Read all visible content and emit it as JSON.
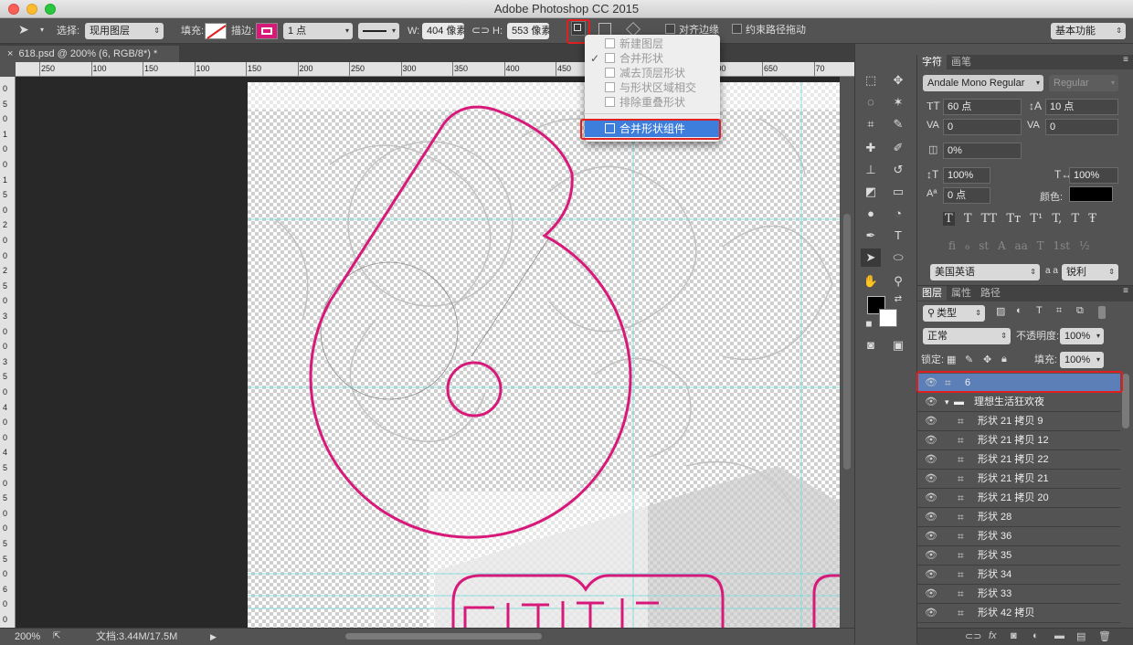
{
  "app_title": "Adobe Photoshop CC 2015",
  "options": {
    "select_label": "选择:",
    "select_value": "现用图层",
    "fill_label": "填充:",
    "stroke_label": "描边:",
    "stroke_size": "1 点",
    "w_label": "W:",
    "w_value": "404 像素",
    "h_label": "H:",
    "h_value": "553 像素",
    "align_edges": "对齐边缘",
    "constrain_path": "约束路径拖动",
    "workspace": "基本功能"
  },
  "document": {
    "tab": "618.psd @ 200% (6, RGB/8*) *"
  },
  "ruler": {
    "h": [
      "250",
      "100",
      "150",
      "100",
      "150",
      "200",
      "250",
      "300",
      "350",
      "400",
      "450",
      "500",
      "550",
      "600",
      "650",
      "70"
    ],
    "v": [
      "0",
      "5",
      "0",
      "1",
      "0",
      "0",
      "1",
      "5",
      "0",
      "2",
      "0",
      "0",
      "2",
      "5",
      "0",
      "3",
      "0",
      "0",
      "3",
      "5",
      "0",
      "4",
      "0",
      "0",
      "4",
      "5",
      "0",
      "5",
      "0",
      "0",
      "5",
      "5",
      "0",
      "6",
      "0",
      "0"
    ]
  },
  "path_menu": {
    "items": [
      {
        "label": "新建图层",
        "checked": false
      },
      {
        "label": "合并形状",
        "checked": true
      },
      {
        "label": "减去顶层形状",
        "checked": false
      },
      {
        "label": "与形状区域相交",
        "checked": false
      },
      {
        "label": "排除重叠形状",
        "checked": false
      }
    ],
    "selected": "合并形状组件"
  },
  "status": {
    "zoom": "200%",
    "doc": "文档:3.44M/17.5M"
  },
  "character": {
    "tabs": [
      "字符",
      "画笔"
    ],
    "font": "Andale Mono Regular",
    "style": "Regular",
    "size": "60 点",
    "leading": "10 点",
    "kerning": "0",
    "tracking": "0",
    "scale_pct": "0%",
    "vscale": "100%",
    "hscale": "100%",
    "baseline": "0 点",
    "color_label": "颜色:",
    "language": "美国英语",
    "aa_label": "a a",
    "antialias": "锐利",
    "type_buttons": [
      "T",
      "T",
      "TT",
      "Tт",
      "T¹",
      "T,",
      "T",
      "Ŧ"
    ],
    "ot_buttons": [
      "fi",
      "ℴ",
      "st",
      "A",
      "aa",
      "T",
      "1st",
      "½"
    ]
  },
  "layers": {
    "tabs": [
      "图层",
      "属性",
      "路径"
    ],
    "filter": "类型",
    "blend": "正常",
    "opacity_label": "不透明度:",
    "opacity": "100%",
    "lock_label": "锁定:",
    "fill_label": "填充:",
    "fill": "100%",
    "rows": [
      {
        "name": "6",
        "selected": true,
        "group": false
      },
      {
        "name": "理想生活狂欢夜",
        "selected": false,
        "group": true
      },
      {
        "name": "形状 21 拷贝 9"
      },
      {
        "name": "形状 21 拷贝 12"
      },
      {
        "name": "形状 21 拷贝 22"
      },
      {
        "name": "形状 21 拷贝 21"
      },
      {
        "name": "形状 21 拷贝 20"
      },
      {
        "name": "形状 28"
      },
      {
        "name": "形状 36"
      },
      {
        "name": "形状 35"
      },
      {
        "name": "形状 34"
      },
      {
        "name": "形状 33"
      },
      {
        "name": "形状 42 拷贝"
      }
    ]
  },
  "colors": {
    "accent": "#3d7ddc",
    "shape_stroke": "#d7197a",
    "highlight": "#e02020"
  }
}
